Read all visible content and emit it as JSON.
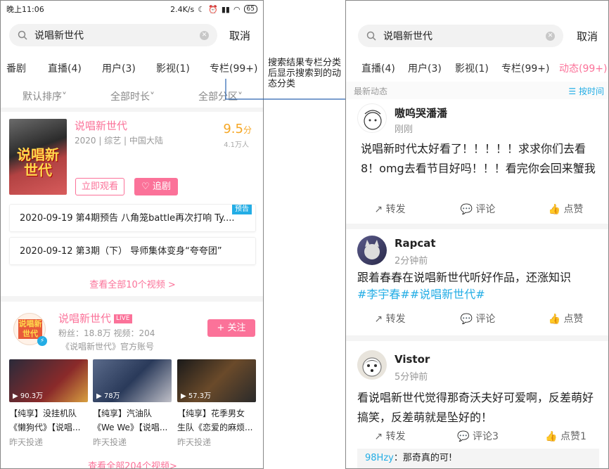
{
  "left": {
    "status": {
      "time": "晚上11:06",
      "speed": "2.4K/s",
      "battery": "65"
    },
    "search": {
      "query": "说唱新世代",
      "cancel": "取消"
    },
    "tabs": [
      "番剧",
      "直播(4)",
      "用户(3)",
      "影视(1)",
      "专栏(99+)"
    ],
    "filters": [
      "默认排序˅",
      "全部时长˅",
      "全部分区˅"
    ],
    "media": {
      "poster_text": "说唱新世代",
      "title": "说唱新世代",
      "meta": "2020 | 综艺 | 中国大陆",
      "score": "9.5",
      "score_unit": "分",
      "score_count": "4.1万人",
      "watch_btn": "立即观看",
      "follow_btn": "追剧"
    },
    "episodes": [
      {
        "text": "2020-09-19 第4期预告 八角笼battle再次打响 Ty....",
        "badge": "预告"
      },
      {
        "text": "2020-09-12 第3期（下） 导师集体变身“夸夸团”",
        "badge": ""
      }
    ],
    "see_all_videos": "查看全部10个视频 >",
    "user": {
      "name": "说唱新世代",
      "live": "LIVE",
      "stats": "粉丝：18.8万     视频：204",
      "desc": "《说唱新世代》官方账号",
      "follow": "+ 关注",
      "avatar_text": "说唱新世代"
    },
    "videos": [
      {
        "dur": "90.3万",
        "line1": "【纯享】没挂机队",
        "line2": "《懒狗代》【说唱...",
        "date": "昨天投递"
      },
      {
        "dur": "78万",
        "line1": "【纯享】汽油队",
        "line2": "《We We》【说唱...",
        "date": "昨天投递"
      },
      {
        "dur": "57.3万",
        "line1": "【纯享】花季男女",
        "line2": "生队《恋爱的麻烦...",
        "date": "昨天投递"
      }
    ],
    "see_all_user_videos": "查看全部204个视频>"
  },
  "annotation": "搜索结果专栏分类后显示搜索到的动态分类",
  "right": {
    "search": {
      "query": "说唱新世代",
      "cancel": "取消"
    },
    "tabs": [
      "直播(4)",
      "用户(3)",
      "影视(1)",
      "专栏(99+)",
      "动态(99+)"
    ],
    "dyn_header": {
      "left": "最新动态",
      "right": "按时间"
    },
    "posts": [
      {
        "name": "嗷呜哭潘潘",
        "time": "刚刚",
        "text": "说唱新时代太好看了！！！！！求求你们去看8！omg去看节目好吗！！！看完你会回来蟹我",
        "topic": "",
        "repost": "转发",
        "comment": "评论",
        "like": "点赞"
      },
      {
        "name": "Rapcat",
        "time": "2分钟前",
        "text": "跟着春春在说唱新世代听好作品，还涨知识",
        "topic": "#李宇春##说唱新世代#",
        "repost": "转发",
        "comment": "评论",
        "like": "点赞"
      },
      {
        "name": "Vistor",
        "time": "5分钟前",
        "text": "看说唱新世代觉得那奇沃夫好可爱啊，反差萌好搞笑，反差萌就是坠好的！",
        "topic": "",
        "repost": "转发",
        "comment": "评论3",
        "like": "点赞1"
      }
    ],
    "comment": {
      "user": "98Hzy",
      "text": "：那奇真的可!"
    }
  },
  "colors": {
    "pink": "#fb7299",
    "blue": "#23ade5",
    "gold": "#f5a623"
  }
}
